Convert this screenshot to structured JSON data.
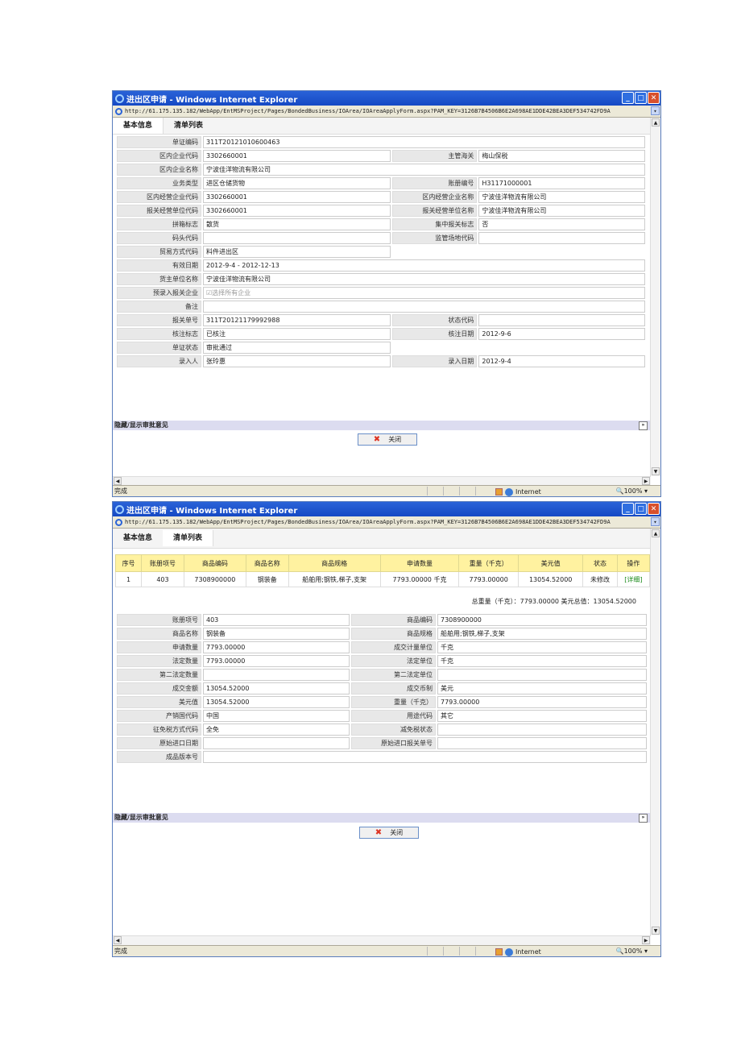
{
  "window_title": "进出区申请 - Windows Internet Explorer",
  "url": "http://61.175.135.182/WebApp/EntMSProject/Pages/BondedBusiness/IOArea/IOAreaApplyForm.aspx?PAM_KEY=3126B7B4506B6E2A698AE1DDE42BEA3DEF534742FD9A",
  "tabs": [
    "基本信息",
    "清单列表"
  ],
  "win1": {
    "rows": [
      {
        "l1": "单证编码",
        "v1": "311T20121010600463",
        "full": true
      },
      {
        "l1": "区内企业代码",
        "v1": "3302660001",
        "l2": "主管海关",
        "v2": "梅山保税"
      },
      {
        "l1": "区内企业名称",
        "v1": "宁波佳洋物流有限公司",
        "full": true
      },
      {
        "l1": "业务类型",
        "v1": "进区仓储货物",
        "l2": "账册编号",
        "v2": "H31171000001"
      },
      {
        "l1": "区内经营企业代码",
        "v1": "3302660001",
        "l2": "区内经营企业名称",
        "v2": "宁波佳洋物流有限公司"
      },
      {
        "l1": "报关经营单位代码",
        "v1": "3302660001",
        "l2": "报关经营单位名称",
        "v2": "宁波佳洋物流有限公司"
      },
      {
        "l1": "拼箱标志",
        "v1": "散货",
        "l2": "集中报关标志",
        "v2": "否"
      },
      {
        "l1": "码头代码",
        "v1": "",
        "l2": "监管场地代码",
        "v2": ""
      },
      {
        "l1": "贸易方式代码",
        "v1": "料件进出区",
        "l2": "",
        "v2": "",
        "half": true
      },
      {
        "l1": "有效日期",
        "v1": "2012-9-4 -   2012-12-13",
        "full": true
      },
      {
        "l1": "货主单位名称",
        "v1": "宁波佳洋物流有限公司",
        "full": true
      },
      {
        "l1": "预录入报关企业",
        "v1": "选择所有企业",
        "full": true,
        "checkbox": true
      },
      {
        "l1": "备注",
        "v1": "",
        "full": true
      },
      {
        "l1": "报关单号",
        "v1": "311T20121179992988",
        "l2": "状态代码",
        "v2": ""
      },
      {
        "l1": "核注标志",
        "v1": "已核注",
        "l2": "核注日期",
        "v2": "2012-9-6"
      },
      {
        "l1": "单证状态",
        "v1": "审批通过",
        "l2": "",
        "v2": "",
        "half": true
      },
      {
        "l1": "录入人",
        "v1": "张玲惠",
        "l2": "录入日期",
        "v2": "2012-9-4"
      }
    ]
  },
  "collapse_label": "隐藏/显示审批意见",
  "close_label": "关闭",
  "status_done": "完成",
  "zone_label": "Internet",
  "zoom_label": "100%",
  "win2": {
    "headers": [
      "序号",
      "账册项号",
      "商品编码",
      "商品名称",
      "商品规格",
      "申请数量",
      "重量（千克）",
      "美元值",
      "状态",
      "操作"
    ],
    "row": [
      "1",
      "403",
      "7308900000",
      "钢装备",
      "船舶用;钢铁,梯子,支架",
      "7793.00000 千克",
      "7793.00000",
      "13054.52000",
      "未修改",
      "[详细]"
    ],
    "summary": "总重量（千克）：7793.00000   美元总值：13054.52000",
    "details": [
      {
        "l1": "账册项号",
        "v1": "403",
        "l2": "商品编码",
        "v2": "7308900000"
      },
      {
        "l1": "商品名称",
        "v1": "钢装备",
        "l2": "商品规格",
        "v2": "船舶用;钢铁,梯子,支架"
      },
      {
        "l1": "申请数量",
        "v1": "7793.00000",
        "l2": "成交计量单位",
        "v2": "千克"
      },
      {
        "l1": "法定数量",
        "v1": "7793.00000",
        "l2": "法定单位",
        "v2": "千克"
      },
      {
        "l1": "第二法定数量",
        "v1": "",
        "l2": "第二法定单位",
        "v2": ""
      },
      {
        "l1": "成交金额",
        "v1": "13054.52000",
        "l2": "成交币制",
        "v2": "美元"
      },
      {
        "l1": "美元值",
        "v1": "13054.52000",
        "l2": "重量（千克）",
        "v2": "7793.00000"
      },
      {
        "l1": "产销国代码",
        "v1": "中国",
        "l2": "用途代码",
        "v2": "其它"
      },
      {
        "l1": "征免税方式代码",
        "v1": "全免",
        "l2": "减免税状态",
        "v2": ""
      },
      {
        "l1": "原始进口日期",
        "v1": "",
        "l2": "原始进口报关单号",
        "v2": ""
      },
      {
        "l1": "成品版本号",
        "v1": "",
        "full": true
      }
    ]
  }
}
